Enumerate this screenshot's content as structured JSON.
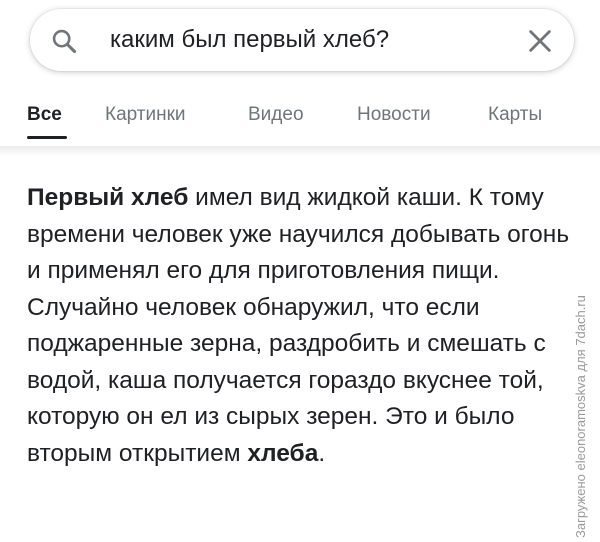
{
  "search": {
    "query": "каким был первый хлеб?",
    "search_icon": "search-icon",
    "clear_icon": "close-icon"
  },
  "tabs": [
    {
      "label": "Все",
      "active": true
    },
    {
      "label": "Картинки",
      "active": false
    },
    {
      "label": "Видео",
      "active": false
    },
    {
      "label": "Новости",
      "active": false
    },
    {
      "label": "Карты",
      "active": false
    }
  ],
  "snippet": {
    "bold_start": "Первый хлеб",
    "text_main": " имел вид жидкой каши. К тому времени человек уже научился добывать огонь и применял его для приготовления пищи. Случайно человек обнаружил, что если поджаренные зерна, раздробить и смешать с водой, каша получается гораздо вкуснее той, которую он ел из сырых зерен. Это и было вторым открытием ",
    "bold_end": "хлеба",
    "text_end": "."
  },
  "watermark": "Загружено eleonoramoskva для 7dach.ru",
  "colors": {
    "text": "#202124",
    "tab_inactive": "#70757a",
    "icon": "#70757a"
  }
}
